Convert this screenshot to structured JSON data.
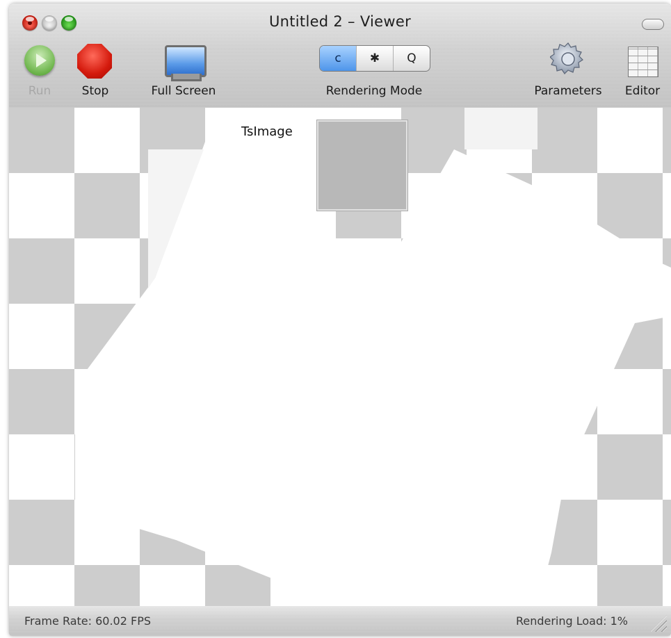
{
  "window": {
    "title": "Untitled 2 – Viewer"
  },
  "toolbar": {
    "run_label": "Run",
    "stop_label": "Stop",
    "full_screen_label": "Full Screen",
    "rendering_mode_label": "Rendering Mode",
    "rendering_mode_options": [
      {
        "icon": "refresh-icon",
        "glyph": "c"
      },
      {
        "icon": "bug-icon",
        "glyph": "✱"
      },
      {
        "icon": "magnifier-icon",
        "glyph": "Q"
      }
    ],
    "parameters_label": "Parameters",
    "editor_label": "Editor"
  },
  "viewer": {
    "port_label": "TsImage",
    "image_color": "#b8b8b8"
  },
  "status": {
    "frame_rate": "Frame Rate:  60.02 FPS",
    "rendering_load": "Rendering Load:  1%"
  }
}
